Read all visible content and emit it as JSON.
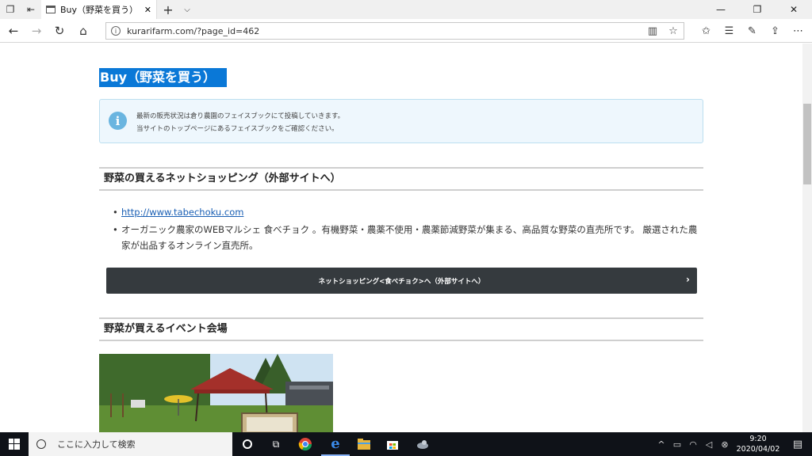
{
  "tab": {
    "title": "Buy（野菜を買う） | 倉り",
    "close": "✕"
  },
  "address": {
    "url": "kurarifarm.com/?page_id=462"
  },
  "page": {
    "heading": "Buy（野菜を買う）",
    "notice": {
      "line1": "最新の販売状況は倉り農園のフェイスブックにて投稿していきます。",
      "line2": "当サイトのトップページにあるフェイスブックをご確認ください。"
    },
    "section1": {
      "title": "野菜の買えるネットショッピング（外部サイトへ）"
    },
    "bullets": {
      "link": "http://www.tabechoku.com",
      "desc_line1": "オーガニック農家のWEBマルシェ 食べチョク 。有機野菜・農薬不使用・農薬節減野菜が集まる、高品質な野菜の直売所です。 厳選された農",
      "desc_line2": "家が出品するオンライン直売所。"
    },
    "button": {
      "label": "ネットショッピング<食べチョク>へ（外部サイトへ）"
    },
    "section2": {
      "title": "野菜が買えるイベント会場"
    }
  },
  "taskbar": {
    "search_placeholder": "ここに入力して検索",
    "time": "9:20",
    "date": "2020/04/02"
  },
  "icons": [
    "tab-actions-icon",
    "back-icon",
    "forward-icon",
    "refresh-icon",
    "home-icon",
    "reading-view-icon",
    "favorite-star-icon",
    "favorites-icon",
    "hub-icon",
    "notes-icon",
    "share-icon",
    "more-icon",
    "windows-start-icon",
    "cortana-icon",
    "task-view-icon",
    "chrome-icon",
    "edge-icon",
    "file-explorer-icon",
    "store-icon",
    "notification-icon"
  ]
}
